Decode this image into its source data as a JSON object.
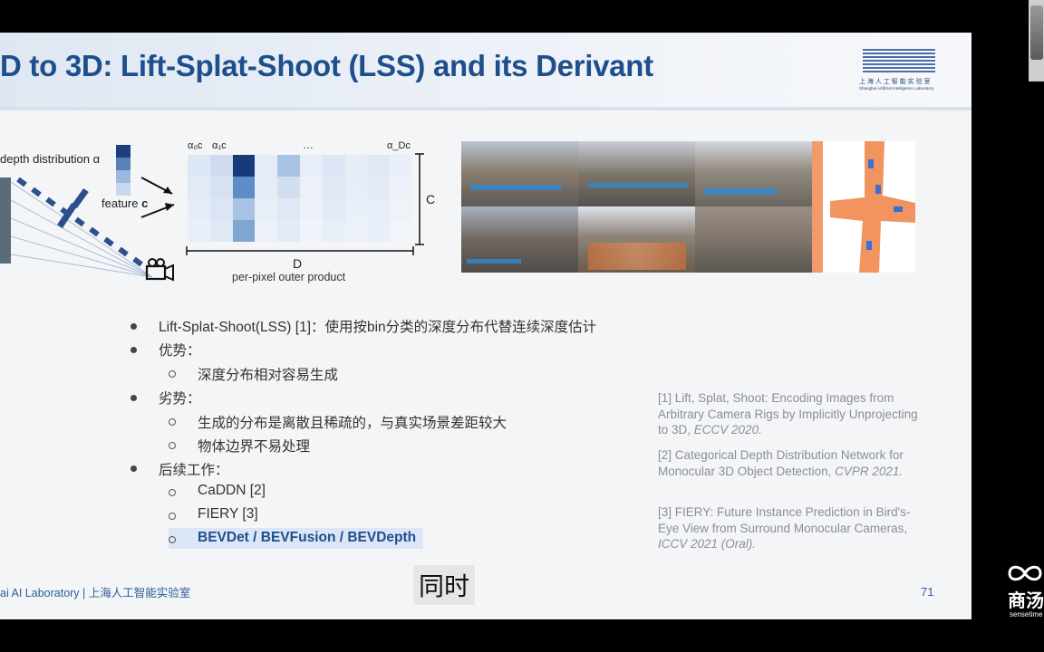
{
  "slide": {
    "title": "D to 3D: Lift-Splat-Shoot (LSS) and its Derivant",
    "logo": {
      "cn": "上 海 人 工 智 能 实 验 室",
      "en": "Shanghai Artificial Intelligence Laboratory"
    },
    "diagram": {
      "depth_label": "depth distribution α",
      "feature_label_prefix": "feature ",
      "feature_label_bold": "c",
      "col_labels": [
        "α₀c",
        "α₁c",
        "…",
        "α_Dc"
      ],
      "c_label": "C",
      "d_label": "D",
      "caption": "per-pixel outer product"
    },
    "bullets": [
      {
        "level": 1,
        "text": "Lift-Splat-Shoot(LSS) [1]：使用按bin分类的深度分布代替连续深度估计"
      },
      {
        "level": 1,
        "text": "优势："
      },
      {
        "level": 2,
        "text": "深度分布相对容易生成"
      },
      {
        "level": 1,
        "text": "劣势："
      },
      {
        "level": 2,
        "text": "生成的分布是离散且稀疏的，与真实场景差距较大"
      },
      {
        "level": 2,
        "text": "物体边界不易处理"
      },
      {
        "level": 1,
        "text": "后续工作："
      },
      {
        "level": 2,
        "text": "CaDDN [2]"
      },
      {
        "level": 2,
        "text": "FIERY [3]"
      },
      {
        "level": 2,
        "text": "BEVDet / BEVFusion / BEVDepth",
        "highlight": true
      }
    ],
    "references": [
      {
        "text": "[1] Lift, Splat, Shoot: Encoding Images from Arbitrary Camera Rigs by Implicitly Unprojecting to 3D, ",
        "venue": "ECCV 2020."
      },
      {
        "text": "[2] Categorical Depth Distribution Network for Monocular 3D Object Detection, ",
        "venue": "CVPR 2021."
      },
      {
        "text": "[3] FIERY: Future Instance Prediction in Bird's-Eye View from Surround Monocular Cameras, ",
        "venue": "ICCV 2021 (Oral)."
      }
    ],
    "footer": "ai AI Laboratory  |  上海人工智能实验室",
    "page_number": "71"
  },
  "subtitle": "同时",
  "brand": {
    "name": "商汤",
    "sub": "sensetime"
  },
  "colors": {
    "title": "#1e4f8c",
    "accent": "#2b5d9c",
    "highlight_bg": "#dce6f6",
    "ref_text": "#8a8f96"
  }
}
